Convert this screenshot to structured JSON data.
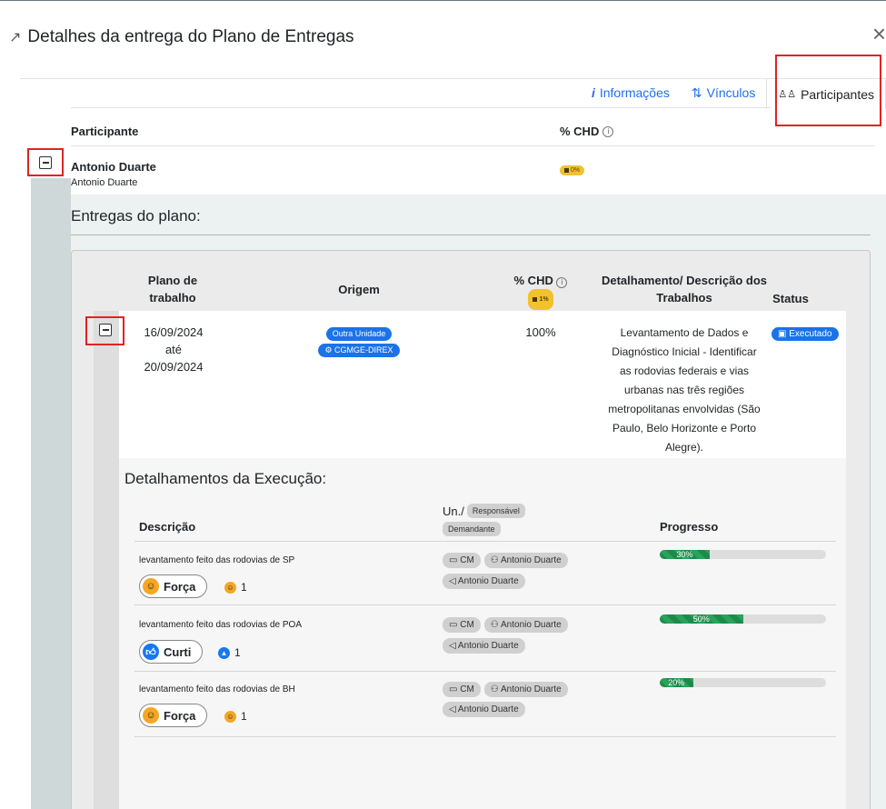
{
  "modal": {
    "title": "Detalhes da entrega do Plano de Entregas",
    "close_glyph": "×",
    "external_icon": "↗",
    "tabs": [
      {
        "icon": "i",
        "label": "Informações"
      },
      {
        "icon": "⇅",
        "label": "Vínculos"
      },
      {
        "icon": "♙♙",
        "label": "Participantes"
      }
    ]
  },
  "participantes": {
    "headers": {
      "participante": "Participante",
      "chd": "% CHD"
    },
    "row": {
      "name": "Antonio Duarte",
      "subtitle": "Antonio Duarte",
      "chd_badge": "0%"
    }
  },
  "entregas": {
    "title": "Entregas do plano:",
    "headers": {
      "plano": "Plano de trabalho",
      "origem": "Origem",
      "chd": "% CHD",
      "chd_badge": "1%",
      "detalhamento": "Detalhamento/ Descrição dos Trabalhos",
      "status": "Status"
    },
    "row": {
      "date_start": "16/09/2024",
      "date_sep": "até",
      "date_end": "20/09/2024",
      "origem_1": "Outra Unidade",
      "origem_2": "CGMGE-DIREX",
      "chd": "100%",
      "detalhamento": "Levantamento de Dados e Diagnóstico Inicial - Identificar as rodovias federais e vias urbanas nas três regiões metropolitanas envolvidas (São Paulo, Belo Horizonte e Porto Alegre).",
      "status": "Executado"
    }
  },
  "execucao": {
    "title": "Detalhamentos da Execução:",
    "headers": {
      "descricao": "Descrição",
      "un": "Un./",
      "responsavel": "Responsável",
      "demandante": "Demandante",
      "progresso": "Progresso"
    },
    "rows": [
      {
        "descricao": "levantamento feito das rodovias de SP",
        "unidade": "CM",
        "responsavel": "Antonio Duarte",
        "demandante": "Antonio Duarte",
        "reaction": "Força",
        "reaction_count": "1",
        "progress": 30,
        "progress_label": "30%"
      },
      {
        "descricao": "levantamento feito das rodovias de POA",
        "unidade": "CM",
        "responsavel": "Antonio Duarte",
        "demandante": "Antonio Duarte",
        "reaction": "Curti",
        "reaction_count": "1",
        "progress": 50,
        "progress_label": "50%"
      },
      {
        "descricao": "levantamento feito das rodovias de BH",
        "unidade": "CM",
        "responsavel": "Antonio Duarte",
        "demandante": "Antonio Duarte",
        "reaction": "Força",
        "reaction_count": "1",
        "progress": 20,
        "progress_label": "20%"
      }
    ]
  },
  "colors": {
    "accent": "#1a73e8",
    "annotation": "#e02424",
    "progress": "#1e8a4a",
    "badge": "#f2c12e"
  }
}
